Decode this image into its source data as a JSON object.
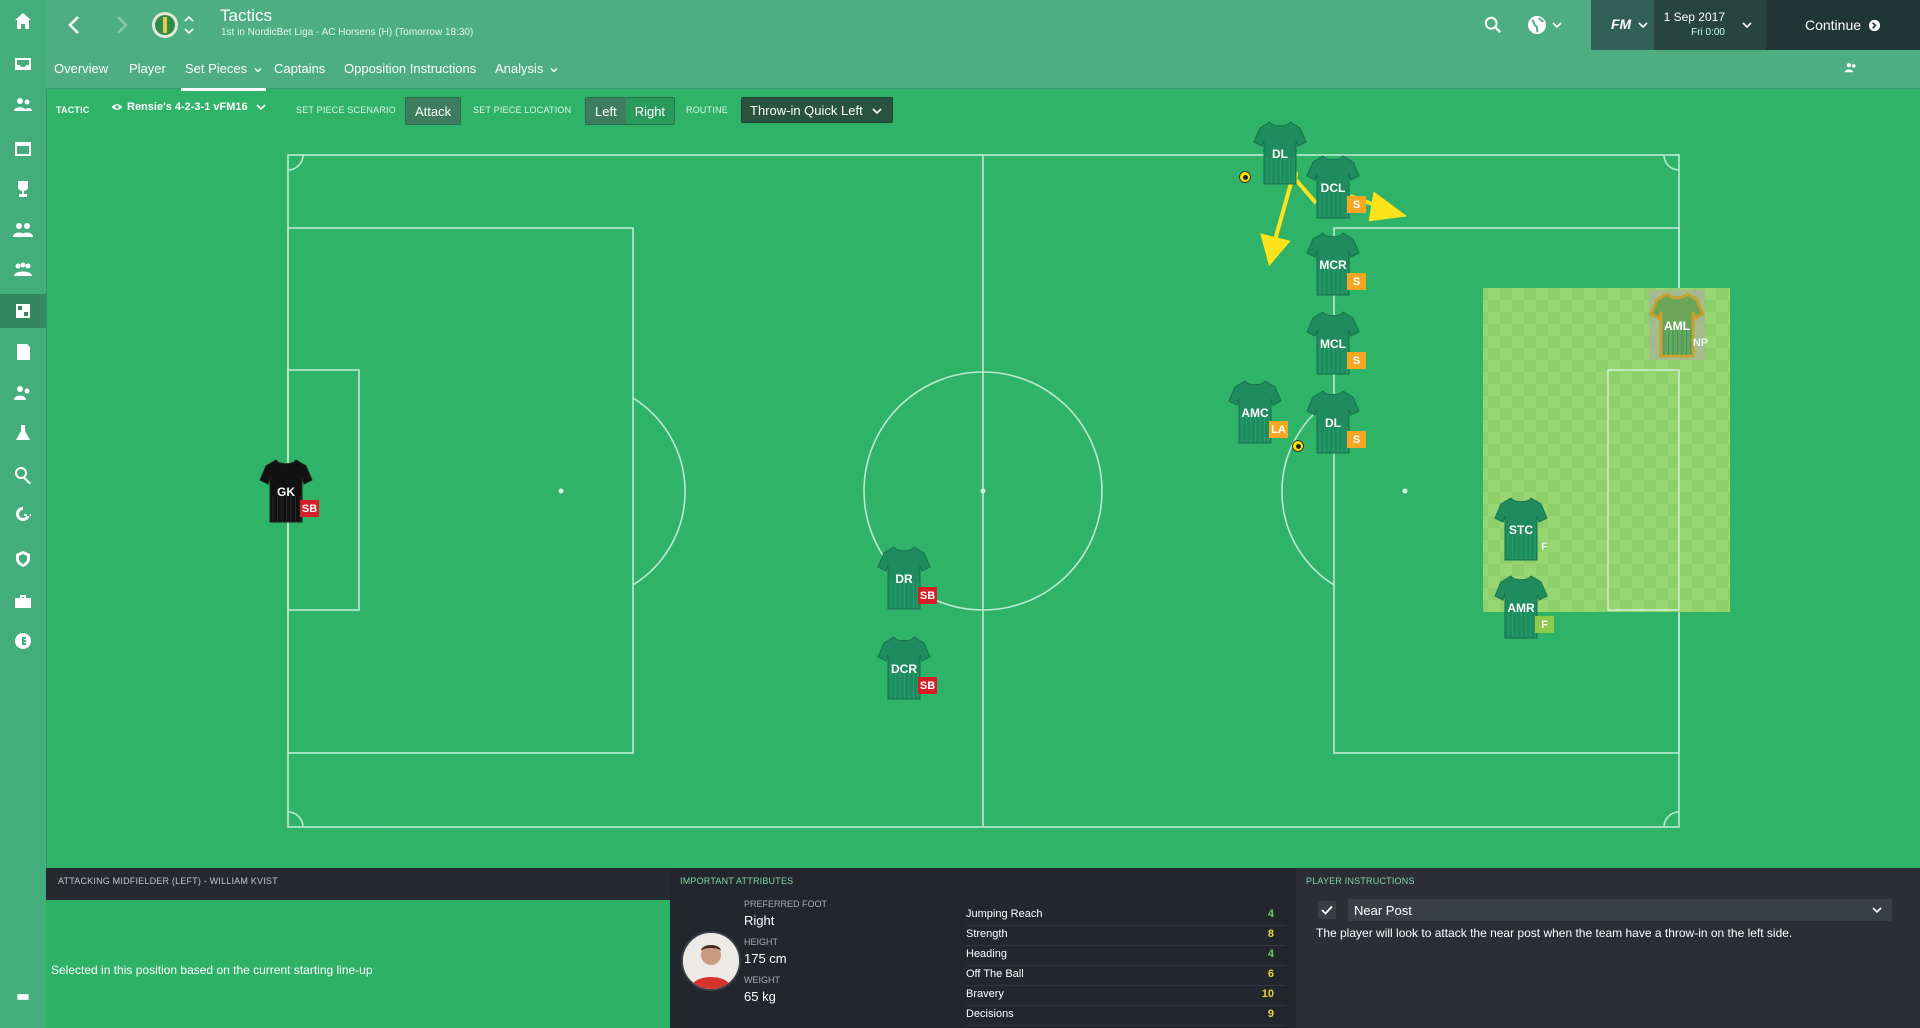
{
  "header": {
    "title": "Tactics",
    "subtitle": "1st in NordicBet Liga - AC Horsens (H) (Tomorrow 18:30)",
    "fm_label": "FM",
    "date": "1 Sep 2017",
    "time": "Fri 0:00",
    "continue_label": "Continue"
  },
  "tabs": [
    "Overview",
    "Player",
    "Set Pieces",
    "Captains",
    "Opposition Instructions",
    "Analysis"
  ],
  "toolbar": {
    "tactic_label": "TACTIC",
    "tactic_name": "Rensie's 4-2-3-1 vFM16",
    "scenario_label": "SET PIECE SCENARIO",
    "scenario_value": "Attack",
    "location_label": "SET PIECE LOCATION",
    "location_left": "Left",
    "location_right": "Right",
    "routine_label": "ROUTINE",
    "routine_value": "Throw-in Quick Left"
  },
  "players": [
    {
      "pos": "GK",
      "role": "SB",
      "role_color": "red",
      "kit": "black"
    },
    {
      "pos": "DR",
      "role": "SB",
      "role_color": "red",
      "kit": "green"
    },
    {
      "pos": "DCR",
      "role": "SB",
      "role_color": "red",
      "kit": "green"
    },
    {
      "pos": "DL",
      "role": "",
      "role_color": "none",
      "kit": "green"
    },
    {
      "pos": "DCL",
      "role": "S",
      "role_color": "orange",
      "kit": "green"
    },
    {
      "pos": "MCR",
      "role": "S",
      "role_color": "orange",
      "kit": "green"
    },
    {
      "pos": "MCL",
      "role": "S",
      "role_color": "orange",
      "kit": "green"
    },
    {
      "pos": "AMC",
      "role": "LA",
      "role_color": "orange",
      "kit": "green"
    },
    {
      "pos": "DL",
      "role": "S",
      "role_color": "orange",
      "kit": "green"
    },
    {
      "pos": "STC",
      "role": "F",
      "role_color": "none",
      "kit": "green"
    },
    {
      "pos": "AMR",
      "role": "F",
      "role_color": "lime",
      "kit": "green"
    },
    {
      "pos": "AML",
      "role": "NP",
      "role_color": "none",
      "kit": "highlight"
    }
  ],
  "selected_player": {
    "heading": "ATTACKING MIDFIELDER (LEFT) - WILLIAM KVIST",
    "note": "Selected in this position based on the current starting line-up"
  },
  "attributes": {
    "heading": "IMPORTANT ATTRIBUTES",
    "preferred_foot_label": "PREFERRED FOOT",
    "preferred_foot": "Right",
    "height_label": "HEIGHT",
    "height": "175 cm",
    "weight_label": "WEIGHT",
    "weight": "65 kg",
    "list": [
      {
        "name": "Jumping Reach",
        "value": "4",
        "color": "#5fd35a"
      },
      {
        "name": "Strength",
        "value": "8",
        "color": "#e9d63a"
      },
      {
        "name": "Heading",
        "value": "4",
        "color": "#5fd35a"
      },
      {
        "name": "Off The Ball",
        "value": "6",
        "color": "#e9d63a"
      },
      {
        "name": "Bravery",
        "value": "10",
        "color": "#e9d63a"
      },
      {
        "name": "Decisions",
        "value": "9",
        "color": "#e9d63a"
      }
    ]
  },
  "instructions": {
    "heading": "PLAYER INSTRUCTIONS",
    "selected": "Near Post",
    "description": "The player will look to attack the near post when the team have a throw-in on the left side."
  },
  "rail_icons": [
    "home-icon",
    "inbox-icon",
    "squad-icon",
    "calendar-icon",
    "trophy-icon",
    "staff-icon",
    "club-icon",
    "tactics-icon",
    "report-icon",
    "training-icon",
    "development-icon",
    "scouting-icon",
    "transfers-icon",
    "club-vision-icon",
    "finances-icon",
    "money-icon"
  ]
}
